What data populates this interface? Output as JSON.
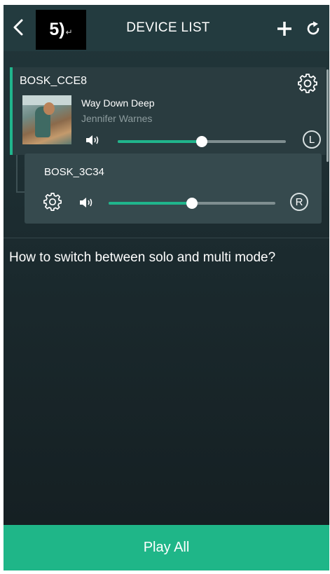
{
  "header": {
    "step_number": "5)",
    "step_mark": "↵",
    "title": "DEVICE LIST"
  },
  "devices": [
    {
      "name": "BOSK_CCE8",
      "now_playing": {
        "title": "Way Down Deep",
        "artist": "Jennifer Warnes"
      },
      "volume": 0.5,
      "channel": "L"
    },
    {
      "name": "BOSK_3C34",
      "volume": 0.5,
      "channel": "R"
    }
  ],
  "help_text": "How to switch between solo and multi mode?",
  "footer": {
    "play_all_label": "Play All"
  },
  "colors": {
    "accent": "#20b58c",
    "background": "#1b2a2e",
    "card": "#2a3c40"
  }
}
